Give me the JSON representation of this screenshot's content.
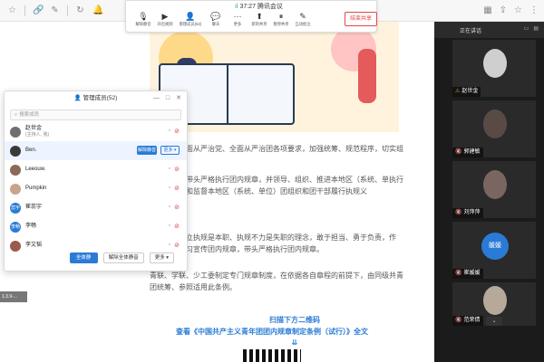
{
  "meeting": {
    "signal": "ıl",
    "time": "37:27",
    "name": "腾讯会议",
    "tools": [
      {
        "icon": "mic-icon",
        "glyph": "🎙",
        "label": "解除静音"
      },
      {
        "icon": "video-icon",
        "glyph": "▶",
        "label": "开启视频"
      },
      {
        "icon": "members-icon",
        "glyph": "👤",
        "label": "管理成员(52)"
      },
      {
        "icon": "chat-icon",
        "glyph": "💬",
        "label": "聊天"
      },
      {
        "icon": "more-icon",
        "glyph": "···",
        "label": "更多"
      },
      {
        "icon": "new-share-icon",
        "glyph": "⬆",
        "label": "新的共享"
      },
      {
        "icon": "pause-share-icon",
        "glyph": "⏸",
        "label": "暂停共享"
      },
      {
        "icon": "annotate-icon",
        "glyph": "✎",
        "label": "互动批注"
      }
    ],
    "end_share": "结束共享"
  },
  "document": {
    "paragraphs": [
      "织要落实全面从严治党、全面从严治团各项要求，加强统筹、规范程序，切实组建设工作。",
      "委员会应当带头严格执行团内规章，并领导、组织、推进本地区（系统、单执行工作，支持和监督本地区（系统、单位）团组织和团干部履行执规义",
      "部要牢固树立执规是本职、执规不力是失职的理念，敢于担当、勇于负责，作制，带头学习宣传团内规章，带头严格执行团内规章。",
      "青联、学联、少工委制定专门规章制度，在依据各自章程的前提下，由同级共青团统筹、参照适用此条例。"
    ],
    "qr_heading": "扫描下方二维码",
    "qr_link": "查看《中国共产主义青年团团内规章制定条例（试行）》全文",
    "qr_arrows": "⇊"
  },
  "members_panel": {
    "title": "管理成员(52)",
    "search_placeholder": "搜索成员",
    "members": [
      {
        "name": "赵世金",
        "role": "(主持人, 我)",
        "avatar_text": "",
        "avatar_color": "#6f6f6f",
        "mic_muted": true,
        "cam_off": true
      },
      {
        "name": "Ben.",
        "role": "",
        "avatar_text": "",
        "avatar_color": "#3a3a3a",
        "mic_muted": true,
        "cam_off": false,
        "highlighted": true
      },
      {
        "name": "Leeouw.",
        "role": "",
        "avatar_text": "",
        "avatar_color": "#8a6a55",
        "mic_muted": true,
        "cam_off": true
      },
      {
        "name": "Pumpkin",
        "role": "",
        "avatar_text": "",
        "avatar_color": "#c9a38a",
        "mic_muted": true,
        "cam_off": true
      },
      {
        "name": "崔蕊宇",
        "role": "",
        "avatar_text": "蕊宇",
        "avatar_color": "#2a7bd6",
        "mic_muted": true,
        "cam_off": true
      },
      {
        "name": "李畅",
        "role": "",
        "avatar_text": "李畅",
        "avatar_color": "#2a7bd6",
        "mic_muted": true,
        "cam_off": true
      },
      {
        "name": "李文韬",
        "role": "",
        "avatar_text": "",
        "avatar_color": "#9b5a4a",
        "mic_muted": true,
        "cam_off": true
      }
    ],
    "row_mute_label": "解除静音",
    "row_more_label": "更多 ▾",
    "footer": {
      "mute_all": "全体静音",
      "unmute_all": "解除全体静音",
      "more": "更多 ▾"
    },
    "window_buttons": {
      "minimize": "—",
      "maximize": "□",
      "close": "✕"
    }
  },
  "side_tag": "1.3.9-...",
  "video_column": {
    "title": "正在讲话",
    "tiles": [
      {
        "name": "赵世金",
        "mic": "⚠",
        "pic_color": "#cfcfcf",
        "host": true
      },
      {
        "name": "郭建敏",
        "mic": "🔇",
        "pic_color": "#5a4a46"
      },
      {
        "name": "刘萍萍",
        "mic": "🔇",
        "pic_color": "#7a6560"
      },
      {
        "name": "崔媛媛",
        "mic": "🔇",
        "circle_text": "媛媛"
      },
      {
        "name": "范荣倩",
        "mic": "🔇",
        "pic_color": "#b7a99a"
      }
    ],
    "scroll_glyph": "⌄"
  },
  "colors": {
    "accent": "#2a7bd6",
    "danger": "#e04848",
    "dark_panel": "#1b1b1b"
  }
}
